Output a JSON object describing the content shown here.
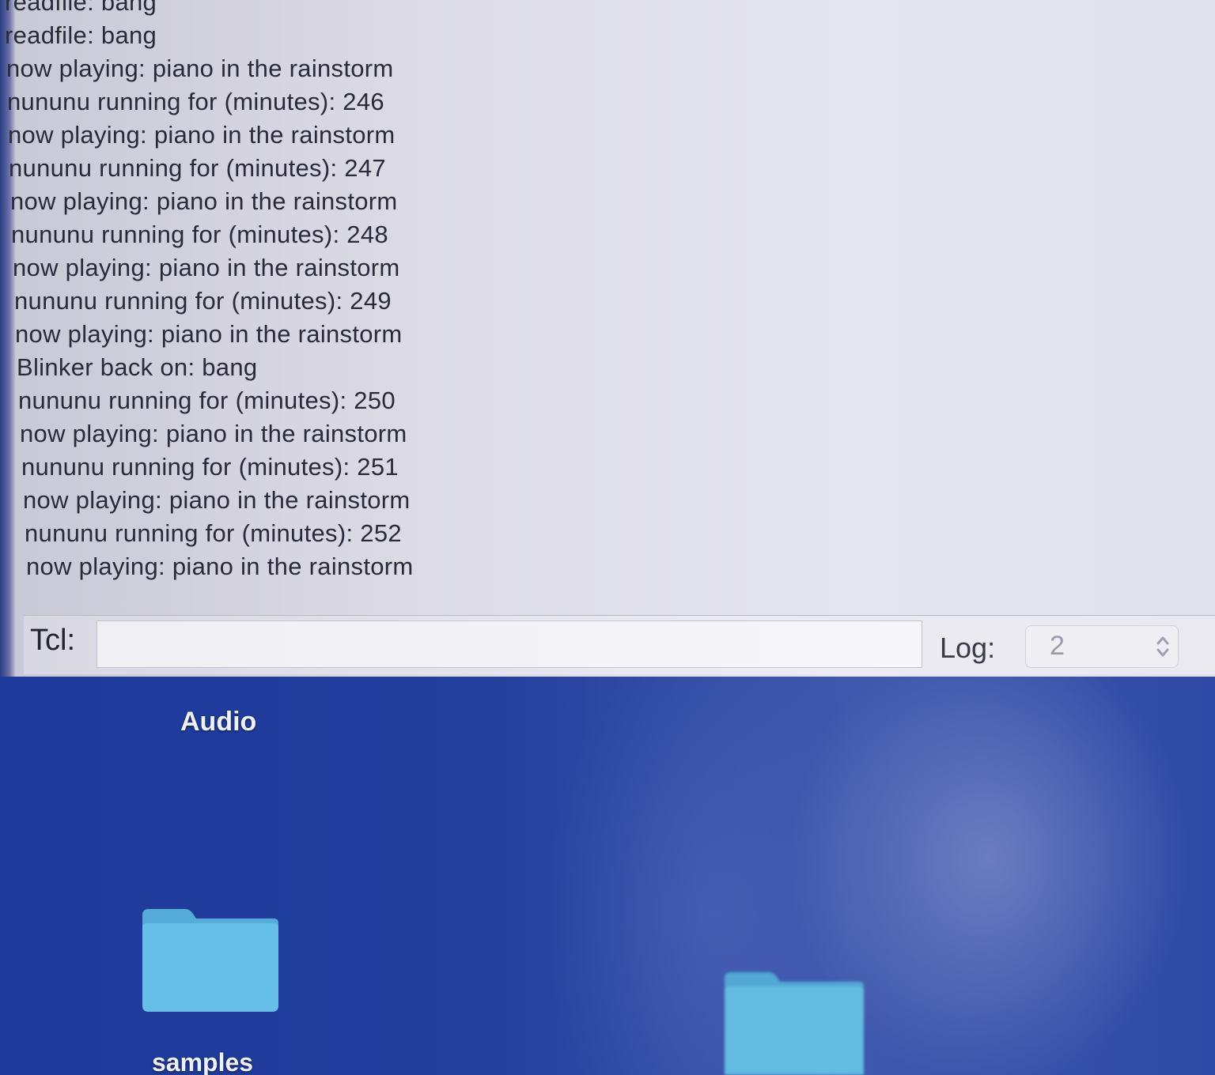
{
  "console": {
    "log_lines": [
      "readfile: bang",
      "readfile: bang",
      "now playing: piano in the rainstorm",
      "nununu running for (minutes): 246",
      "now playing: piano in the rainstorm",
      "nununu running for (minutes): 247",
      "now playing: piano in the rainstorm",
      "nununu running for (minutes): 248",
      "now playing: piano in the rainstorm",
      "nununu running for (minutes): 249",
      "now playing: piano in the rainstorm",
      "Blinker back on: bang",
      "nununu running for (minutes): 250",
      "now playing: piano in the rainstorm",
      "nununu running for (minutes): 251",
      "now playing: piano in the rainstorm",
      "nununu running for (minutes): 252",
      "now playing: piano in the rainstorm"
    ],
    "tcl_label": "Tcl:",
    "tcl_value": "",
    "log_label": "Log:",
    "log_level": "2",
    "stepper_icon": "up-down-chevron-icon"
  },
  "desktop": {
    "section_label": "Audio",
    "folders": [
      {
        "label": "samples",
        "icon": "folder-icon"
      },
      {
        "label": "",
        "icon": "folder-icon"
      }
    ]
  },
  "colors": {
    "folder": "#5cb6e0",
    "desktop_blue": "#23409e",
    "console_text": "#2a2a3a"
  }
}
